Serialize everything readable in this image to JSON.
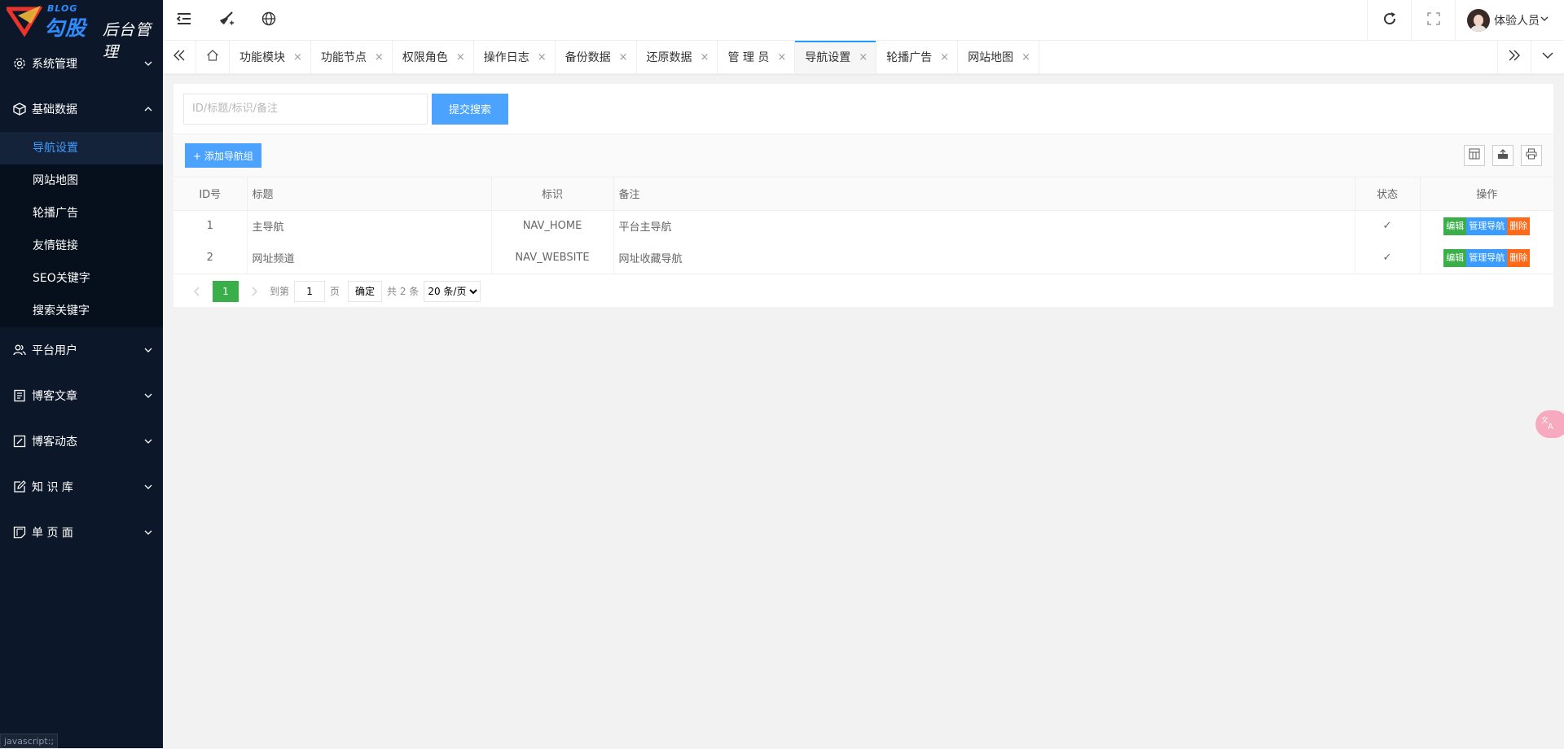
{
  "logo": {
    "blog": "BLOG",
    "main": "勾股",
    "sub": "后台管理"
  },
  "sidebar": {
    "groups": [
      {
        "label": "系统管理",
        "icon": "gear-icon"
      },
      {
        "label": "基础数据",
        "icon": "cube-icon"
      },
      {
        "label": "平台用户",
        "icon": "users-icon"
      },
      {
        "label": "博客文章",
        "icon": "article-icon"
      },
      {
        "label": "博客动态",
        "icon": "edit-square-icon"
      },
      {
        "label": "知 识 库",
        "icon": "pencil-square-icon"
      },
      {
        "label": "单 页 面",
        "icon": "page-icon"
      }
    ],
    "sub_items": [
      "导航设置",
      "网站地图",
      "轮播广告",
      "友情链接",
      "SEO关键字",
      "搜索关键字"
    ],
    "active_sub": "导航设置"
  },
  "header": {
    "user_name": "体验人员"
  },
  "tabs": [
    {
      "label": "功能模块"
    },
    {
      "label": "功能节点"
    },
    {
      "label": "权限角色"
    },
    {
      "label": "操作日志"
    },
    {
      "label": "备份数据"
    },
    {
      "label": "还原数据"
    },
    {
      "label": "管 理 员"
    },
    {
      "label": "导航设置",
      "active": true
    },
    {
      "label": "轮播广告"
    },
    {
      "label": "网站地图"
    }
  ],
  "tab_close_glyph": "×",
  "search": {
    "placeholder": "ID/标题/标识/备注",
    "button": "提交搜索"
  },
  "toolbar": {
    "add_button": "+ 添加导航组"
  },
  "table": {
    "headers": [
      "ID号",
      "标题",
      "标识",
      "备注",
      "状态",
      "操作"
    ],
    "rows": [
      {
        "id": "1",
        "title": "主导航",
        "key": "NAV_HOME",
        "remark": "平台主导航",
        "status": "✓"
      },
      {
        "id": "2",
        "title": "网址频道",
        "key": "NAV_WEBSITE",
        "remark": "网址收藏导航",
        "status": "✓"
      }
    ],
    "ops": {
      "edit": "编辑",
      "manage": "管理导航",
      "delete": "删除"
    }
  },
  "pager": {
    "current": "1",
    "goto_label": "到第",
    "goto_value": "1",
    "page_unit": "页",
    "confirm": "确定",
    "total": "共 2 条",
    "page_size": "20 条/页"
  },
  "status_hint": "javascript:;",
  "colors": {
    "sidebar_bg": "#0c1829",
    "accent": "#1e9fff",
    "green": "#3aaf49",
    "orange": "#ff6a1a"
  }
}
